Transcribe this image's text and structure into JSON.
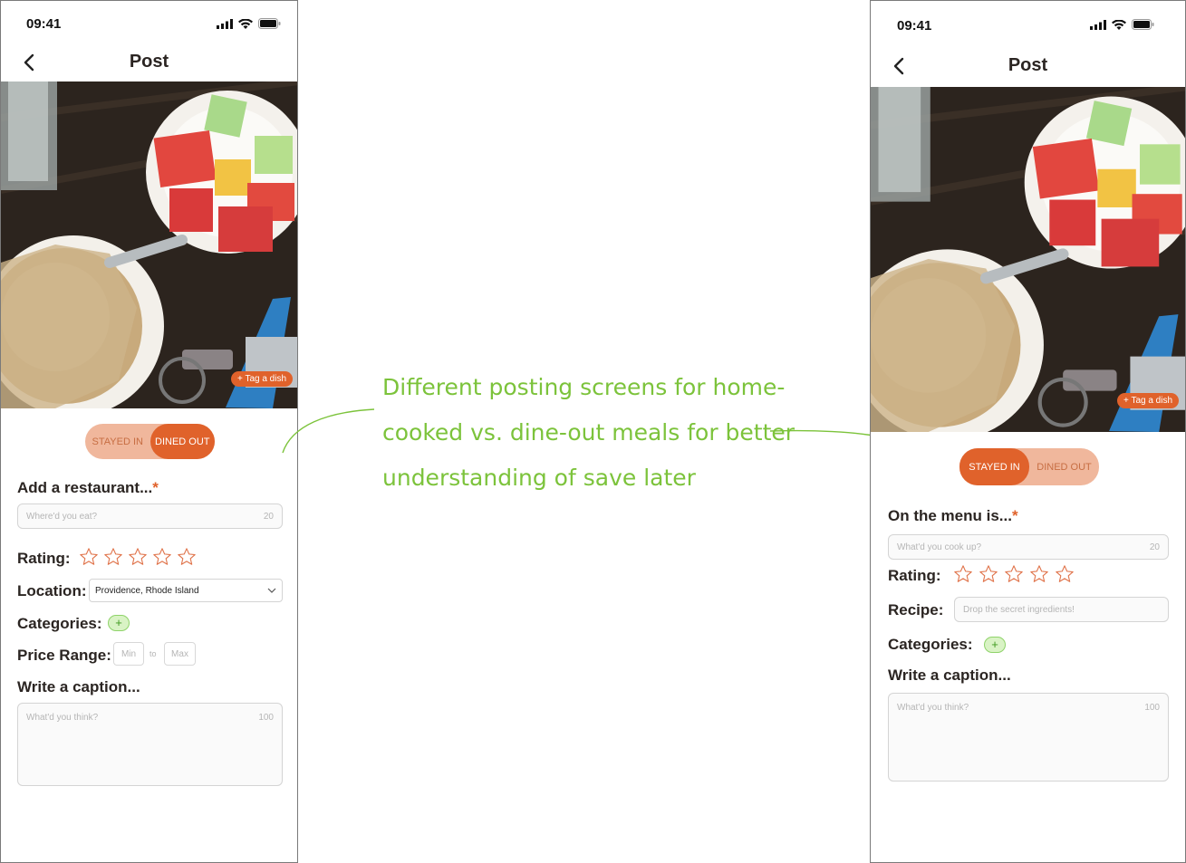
{
  "annotation": {
    "line1": "Different posting screens for home-",
    "line2": "cooked vs. dine-out meals for better",
    "line3": "understanding of save later",
    "color": "#7cc33b"
  },
  "colors": {
    "accent": "#e0622b",
    "toggle_bg": "#f0b79c",
    "plus_green": "#d9f3c5"
  },
  "left_screen": {
    "status_time": "09:41",
    "title": "Post",
    "tag_dish": "+ Tag a dish",
    "toggle": {
      "stayed_in": "STAYED IN",
      "dined_out": "DINED OUT",
      "selected": "DINED OUT"
    },
    "restaurant_label": "Add a restaurant...",
    "required_mark": "*",
    "restaurant_placeholder": "Where'd you eat?",
    "restaurant_count": "20",
    "rating_label": "Rating:",
    "rating_stars": 0,
    "location_label": "Location:",
    "location_value": "Providence, Rhode Island",
    "categories_label": "Categories:",
    "categories_add": "+",
    "price_label": "Price Range:",
    "price_min": "Min",
    "price_to": "to",
    "price_max": "Max",
    "caption_label": "Write a caption...",
    "caption_placeholder": "What'd you think?",
    "caption_count": "100"
  },
  "right_screen": {
    "status_time": "09:41",
    "title": "Post",
    "tag_dish": "+ Tag a dish",
    "toggle": {
      "stayed_in": "STAYED IN",
      "dined_out": "DINED OUT",
      "selected": "STAYED IN"
    },
    "menu_label": "On the menu is...",
    "required_mark": "*",
    "menu_placeholder": "What'd you cook up?",
    "menu_count": "20",
    "rating_label": "Rating:",
    "rating_stars": 0,
    "recipe_label": "Recipe:",
    "recipe_placeholder": "Drop the secret ingredients!",
    "categories_label": "Categories:",
    "categories_add": "+",
    "caption_label": "Write a caption...",
    "caption_placeholder": "What'd you think?",
    "caption_count": "100"
  }
}
